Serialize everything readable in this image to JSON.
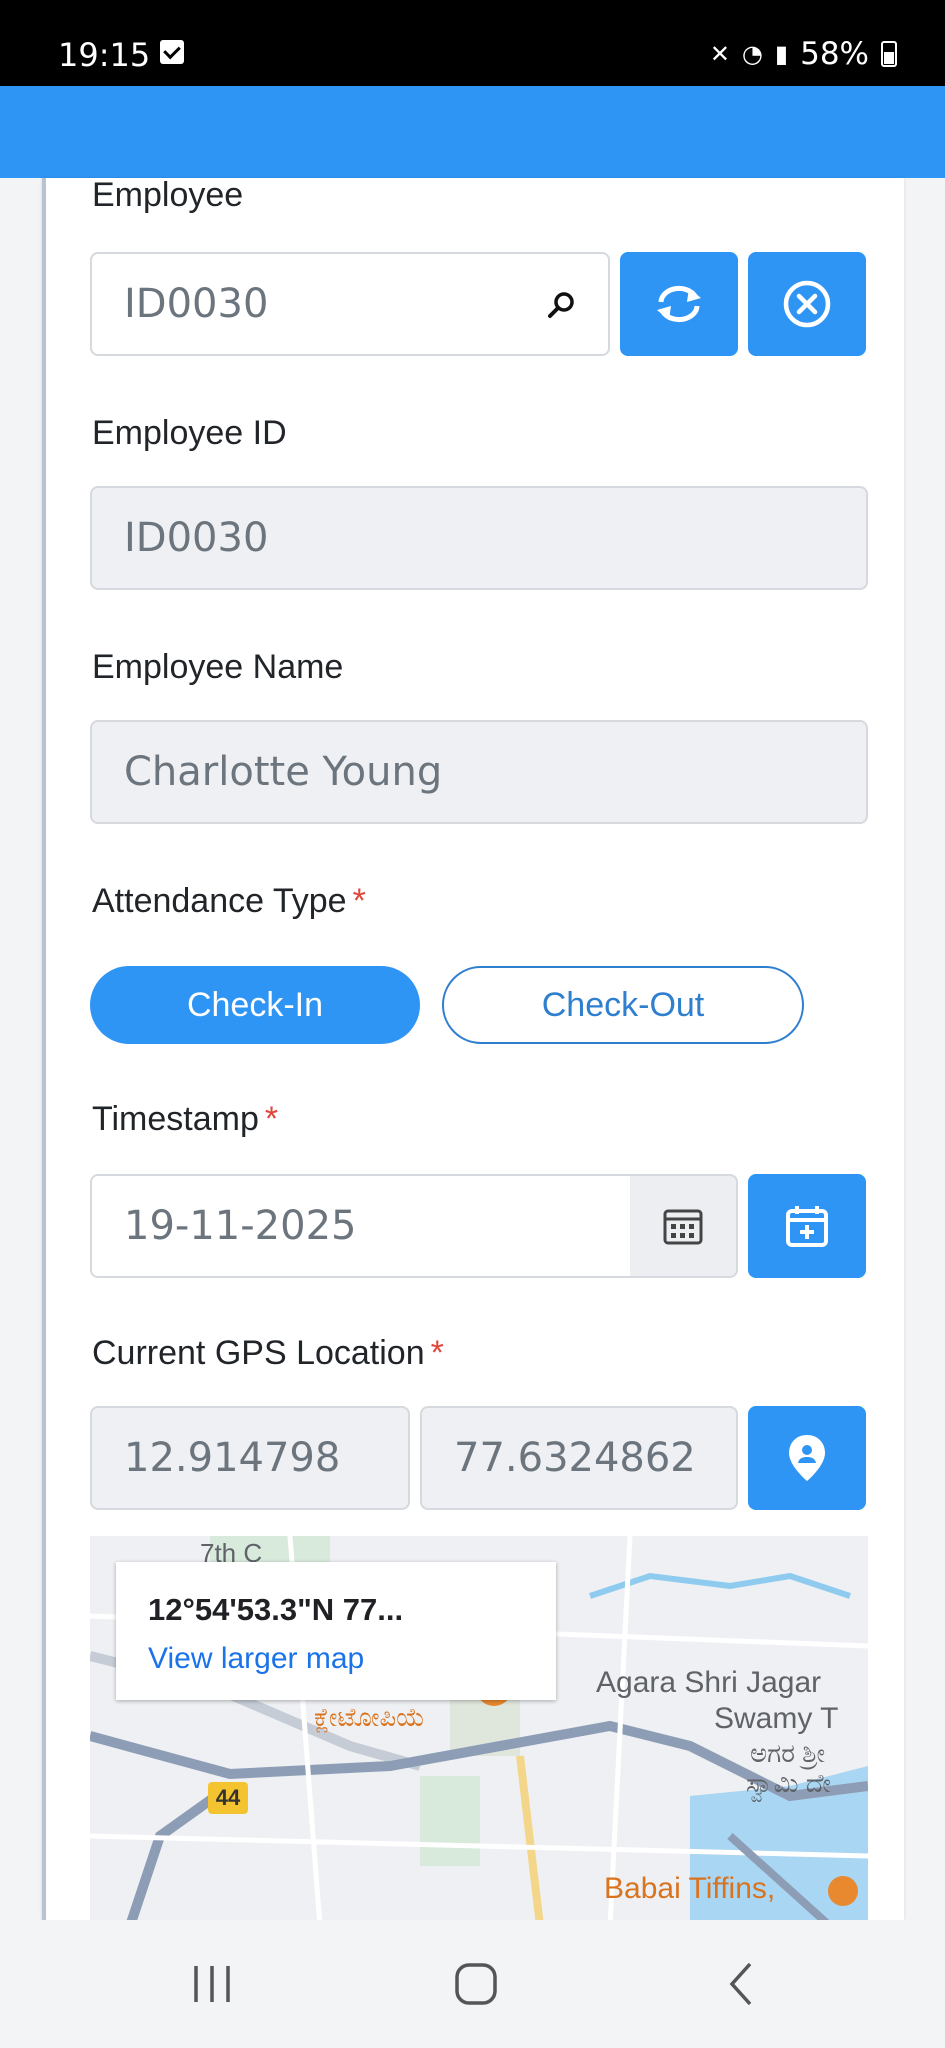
{
  "status_bar": {
    "time": "19:15",
    "battery": "58%"
  },
  "form": {
    "employee": {
      "label": "Employee",
      "value": "ID0030"
    },
    "employee_id": {
      "label": "Employee ID",
      "value": "ID0030"
    },
    "employee_name": {
      "label": "Employee Name",
      "value": "Charlotte Young"
    },
    "attendance": {
      "label": "Attendance Type",
      "required": "*",
      "options": [
        "Check-In",
        "Check-Out"
      ]
    },
    "timestamp": {
      "label": "Timestamp",
      "required": "*",
      "value": "19-11-2025"
    },
    "gps": {
      "label": "Current GPS Location",
      "required": "*",
      "latitude": "12.914798",
      "longitude": "77.6324862"
    }
  },
  "map": {
    "popup_coords": "12°54'53.3\"N 77...",
    "popup_link": "View larger map",
    "labels": {
      "top": "7th C",
      "place_kn": "ಕ್ಲೇಟೋಪಿಯೆ",
      "agara_line1": "Agara Shri Jagar",
      "agara_line2": "Swamy T",
      "agara_kn1": "ಅಗರ ಶ್ರೀ",
      "agara_kn2": "ಸ್ವಾಮಿ ದೇ",
      "road": "44",
      "babai": "Babai Tiffins,"
    }
  },
  "colors": {
    "primary": "#2f95f5",
    "appbar": "#2f95f5",
    "required": "#e0453a"
  },
  "icons": [
    "search-icon",
    "refresh-icon",
    "clear-icon",
    "calendar-icon",
    "calendar-add-icon",
    "location-icon"
  ]
}
